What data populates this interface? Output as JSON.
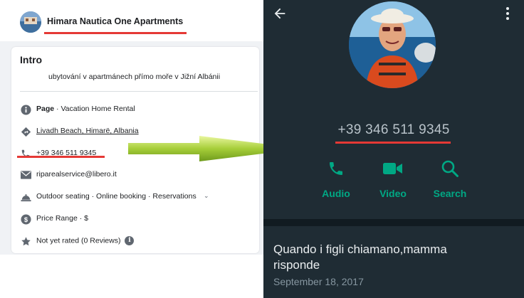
{
  "facebook": {
    "page_title": "Himara Nautica One Apartments",
    "intro": {
      "title": "Intro",
      "description": "ubytování v apartmánech přímo moře v Jižní Albánii"
    },
    "details": {
      "category_bold": "Page",
      "category_rest": " · Vacation Home Rental",
      "address": "Livadh Beach, Himarë, Albania",
      "phone": "+39 346 511 9345",
      "email": "riparealservice@libero.it",
      "services": "Outdoor seating · Online booking · Reservations",
      "price": "Price Range · $",
      "rating": "Not yet rated (0 Reviews)"
    }
  },
  "whatsapp": {
    "phone": "+39 346 511 9345",
    "actions": [
      {
        "label": "Audio",
        "icon": "phone-icon"
      },
      {
        "label": "Video",
        "icon": "video-icon"
      },
      {
        "label": "Search",
        "icon": "search-icon"
      }
    ],
    "about": "Quando i figli chiamano,mamma risponde",
    "about_date": "September 18, 2017"
  },
  "colors": {
    "highlight_underline": "#e53935",
    "whatsapp_accent": "#00a884",
    "whatsapp_bg": "#1f2c34",
    "arrow": "#a6ce39"
  }
}
